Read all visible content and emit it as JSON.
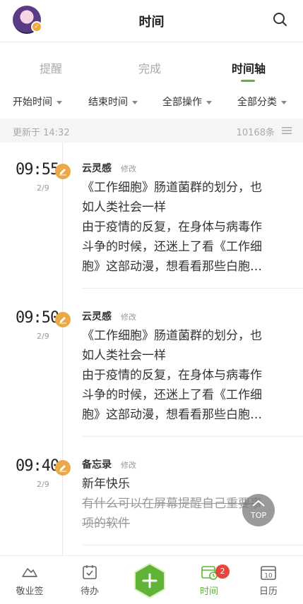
{
  "header": {
    "title": "时间"
  },
  "tabs": [
    {
      "label": "提醒"
    },
    {
      "label": "完成"
    },
    {
      "label": "时间轴"
    }
  ],
  "filters": [
    {
      "label": "开始时间"
    },
    {
      "label": "结束时间"
    },
    {
      "label": "全部操作"
    },
    {
      "label": "全部分类"
    }
  ],
  "status": {
    "updated": "更新于 14:32",
    "count": "10168条"
  },
  "entries": [
    {
      "time": "09:55",
      "date": "2/9",
      "author": "云灵感",
      "action": "修改",
      "lines": [
        "《工作细胞》肠道菌群的划分，也",
        "如人类社会一样",
        "由于疫情的反复，在身体与病毒作",
        "斗争的时候，还迷上了看《工作细",
        "胞》这部动漫，想看看那些白胞…"
      ]
    },
    {
      "time": "09:50",
      "date": "2/9",
      "author": "云灵感",
      "action": "修改",
      "lines": [
        "《工作细胞》肠道菌群的划分，也",
        "如人类社会一样",
        "由于疫情的反复，在身体与病毒作",
        "斗争的时候，还迷上了看《工作细",
        "胞》这部动漫，想看看那些白胞…"
      ]
    },
    {
      "time": "09:40",
      "date": "2/9",
      "author": "备忘录",
      "action": "修改",
      "lines": [
        "新年快乐"
      ],
      "muted_lines": [
        "有什么可以在屏幕提醒自己重要事",
        "项的软件"
      ]
    }
  ],
  "top_button": {
    "label": "TOP"
  },
  "bottom_nav": [
    {
      "label": "敬业签",
      "icon": "cloud-icon"
    },
    {
      "label": "待办",
      "icon": "checklist-icon"
    },
    {
      "label": "",
      "icon": "add-icon"
    },
    {
      "label": "时间",
      "icon": "calendar-clock-icon",
      "badge": "2"
    },
    {
      "label": "日历",
      "icon": "calendar-icon",
      "day": "10"
    }
  ],
  "colors": {
    "accent": "#5fb336",
    "badge_orange": "#eba847",
    "notify_red": "#e8453c"
  }
}
